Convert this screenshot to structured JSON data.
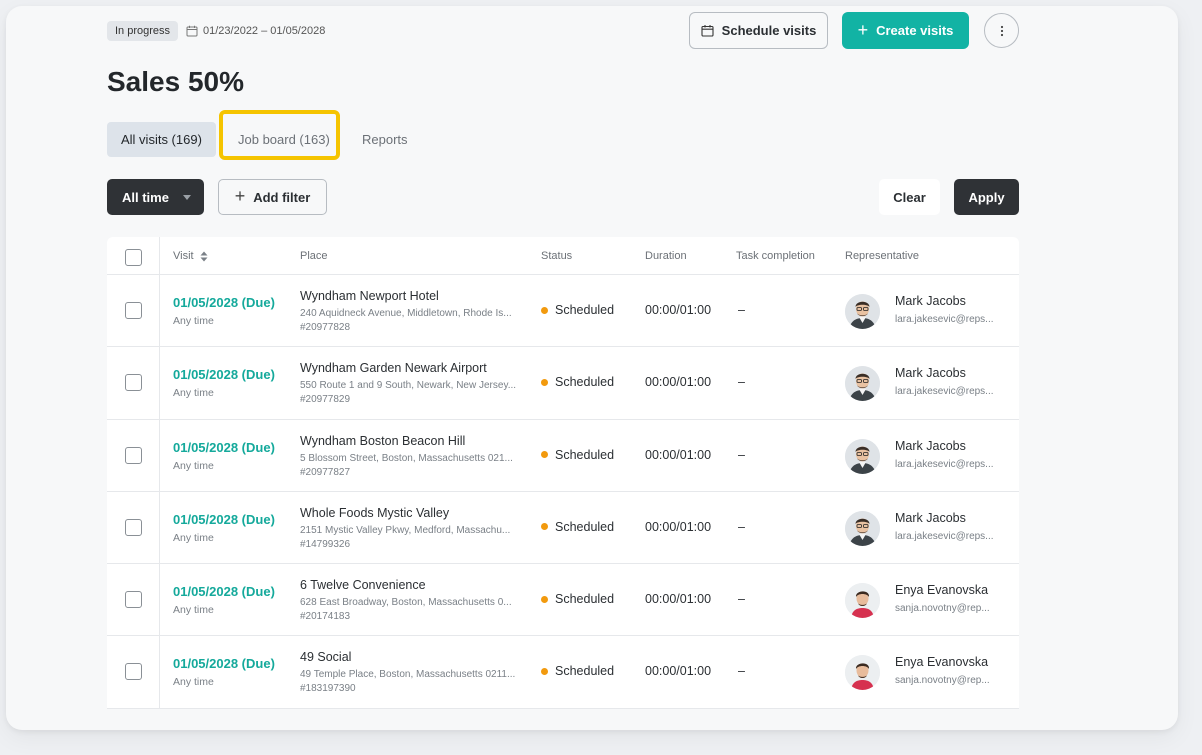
{
  "header": {
    "status_label": "In progress",
    "date_range": "01/23/2022 – 01/05/2028",
    "schedule_button": "Schedule visits",
    "create_button": "Create visits",
    "accent_color": "#12b3a4"
  },
  "page_title": "Sales 50%",
  "tabs": [
    {
      "label": "All visits (169)",
      "active": true
    },
    {
      "label": "Job board (163)",
      "active": false,
      "highlighted": true
    },
    {
      "label": "Reports",
      "active": false
    }
  ],
  "filters": {
    "time_filter": "All time",
    "add_filter": "Add filter",
    "clear": "Clear",
    "apply": "Apply"
  },
  "table": {
    "columns": [
      "Visit",
      "Place",
      "Status",
      "Duration",
      "Task completion",
      "Representative"
    ],
    "rows": [
      {
        "date": "01/05/2028 (Due)",
        "time": "Any time",
        "place": "Wyndham Newport Hotel",
        "address": "240 Aquidneck Avenue, Middletown, Rhode Is...",
        "id": "#20977828",
        "status": "Scheduled",
        "duration": "00:00/01:00",
        "task": "–",
        "rep_name": "Mark Jacobs",
        "rep_email": "lara.jakesevic@reps...",
        "avatar": "male-avatar"
      },
      {
        "date": "01/05/2028 (Due)",
        "time": "Any time",
        "place": "Wyndham Garden Newark Airport",
        "address": "550 Route 1 and 9 South, Newark, New Jersey...",
        "id": "#20977829",
        "status": "Scheduled",
        "duration": "00:00/01:00",
        "task": "–",
        "rep_name": "Mark Jacobs",
        "rep_email": "lara.jakesevic@reps...",
        "avatar": "male-avatar"
      },
      {
        "date": "01/05/2028 (Due)",
        "time": "Any time",
        "place": "Wyndham Boston Beacon Hill",
        "address": "5 Blossom Street, Boston, Massachusetts 021...",
        "id": "#20977827",
        "status": "Scheduled",
        "duration": "00:00/01:00",
        "task": "–",
        "rep_name": "Mark Jacobs",
        "rep_email": "lara.jakesevic@reps...",
        "avatar": "male-avatar"
      },
      {
        "date": "01/05/2028 (Due)",
        "time": "Any time",
        "place": "Whole Foods Mystic Valley",
        "address": "2151 Mystic Valley Pkwy, Medford, Massachu...",
        "id": "#14799326",
        "status": "Scheduled",
        "duration": "00:00/01:00",
        "task": "–",
        "rep_name": "Mark Jacobs",
        "rep_email": "lara.jakesevic@reps...",
        "avatar": "male-avatar"
      },
      {
        "date": "01/05/2028 (Due)",
        "time": "Any time",
        "place": "6 Twelve Convenience",
        "address": "628 East Broadway, Boston, Massachusetts 0...",
        "id": "#20174183",
        "status": "Scheduled",
        "duration": "00:00/01:00",
        "task": "–",
        "rep_name": "Enya Evanovska",
        "rep_email": "sanja.novotny@rep...",
        "avatar": "female-avatar"
      },
      {
        "date": "01/05/2028 (Due)",
        "time": "Any time",
        "place": "49 Social",
        "address": "49 Temple Place, Boston, Massachusetts 0211...",
        "id": "#183197390",
        "status": "Scheduled",
        "duration": "00:00/01:00",
        "task": "–",
        "rep_name": "Enya Evanovska",
        "rep_email": "sanja.novotny@rep...",
        "avatar": "female-avatar"
      }
    ]
  },
  "colors": {
    "visit_date": "#14a99b",
    "status_scheduled": "#f29a0e",
    "highlight": "#f5c400"
  }
}
